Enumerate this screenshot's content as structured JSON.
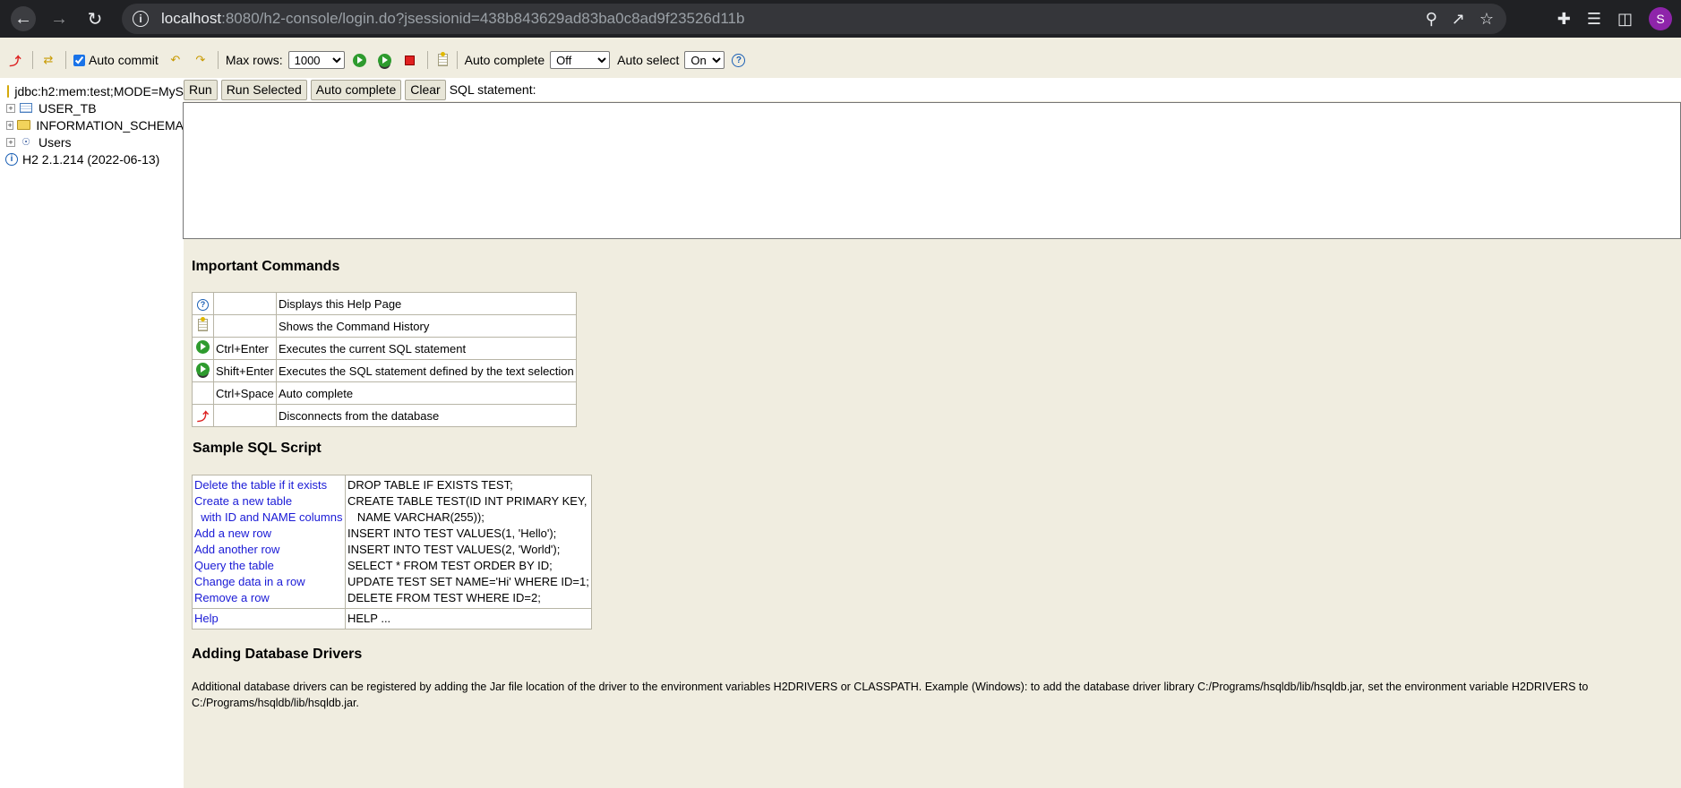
{
  "browser": {
    "url_host": "localhost",
    "url_rest": ":8080/h2-console/login.do?jsessionid=438b843629ad83ba0c8ad9f23526d11b",
    "avatar_letter": "S"
  },
  "toolbar": {
    "auto_commit_label": "Auto commit",
    "auto_commit_checked": true,
    "max_rows_label": "Max rows:",
    "max_rows_value": "1000",
    "auto_complete_label": "Auto complete",
    "auto_complete_value": "Off",
    "auto_select_label": "Auto select",
    "auto_select_value": "On"
  },
  "tree": {
    "connection": "jdbc:h2:mem:test;MODE=MyS",
    "items": [
      {
        "label": "USER_TB",
        "icon": "table-icon"
      },
      {
        "label": "INFORMATION_SCHEMA",
        "icon": "folder-icon"
      },
      {
        "label": "Users",
        "icon": "users-icon"
      }
    ],
    "version": "H2 2.1.214 (2022-06-13)"
  },
  "querybar": {
    "run": "Run",
    "run_selected": "Run Selected",
    "auto_complete": "Auto complete",
    "clear": "Clear",
    "sql_label": "SQL statement:"
  },
  "help": {
    "important_title": "Important Commands",
    "commands": [
      {
        "icon": "help-icon",
        "key": "",
        "desc": "Displays this Help Page"
      },
      {
        "icon": "history-icon",
        "key": "",
        "desc": "Shows the Command History"
      },
      {
        "icon": "run-icon",
        "key": "Ctrl+Enter",
        "desc": "Executes the current SQL statement"
      },
      {
        "icon": "run-selected-icon",
        "key": "Shift+Enter",
        "desc": "Executes the SQL statement defined by the text selection"
      },
      {
        "icon": "",
        "key": "Ctrl+Space",
        "desc": "Auto complete"
      },
      {
        "icon": "disconnect-icon",
        "key": "",
        "desc": "Disconnects from the database"
      }
    ],
    "sample_title": "Sample SQL Script",
    "sample": [
      {
        "link": "Delete the table if it exists",
        "sql": "DROP TABLE IF EXISTS TEST;"
      },
      {
        "link": "Create a new table",
        "sql": "CREATE TABLE TEST(ID INT PRIMARY KEY,"
      },
      {
        "link": "  with ID and NAME columns",
        "sql": "   NAME VARCHAR(255));"
      },
      {
        "link": "Add a new row",
        "sql": "INSERT INTO TEST VALUES(1, 'Hello');"
      },
      {
        "link": "Add another row",
        "sql": "INSERT INTO TEST VALUES(2, 'World');"
      },
      {
        "link": "Query the table",
        "sql": "SELECT * FROM TEST ORDER BY ID;"
      },
      {
        "link": "Change data in a row",
        "sql": "UPDATE TEST SET NAME='Hi' WHERE ID=1;"
      },
      {
        "link": "Remove a row",
        "sql": "DELETE FROM TEST WHERE ID=2;"
      }
    ],
    "help_link": "Help",
    "help_sql": "HELP ...",
    "drivers_title": "Adding Database Drivers",
    "drivers_text_1": "Additional database drivers can be registered by adding the Jar file location of the driver to the environment variables H2DRIVERS or CLASSPATH. Example (Windows): to add the database driver library C:/Programs/hsqldb/lib/hsqldb.jar, set the environment variable H2DRIVERS to",
    "drivers_text_2": "C:/Programs/hsqldb/lib/hsqldb.jar."
  }
}
